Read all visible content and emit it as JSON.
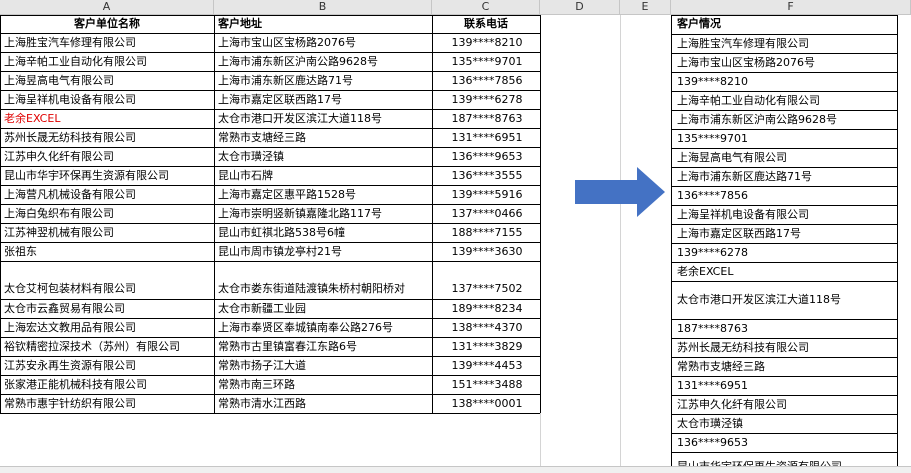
{
  "columns": [
    "A",
    "B",
    "C",
    "D",
    "E",
    "F"
  ],
  "left_headers": [
    "客户单位名称",
    "客户地址",
    "联系电话"
  ],
  "right_header": "客户情况",
  "rows": [
    {
      "name": "上海胜宝汽车修理有限公司",
      "addr": "上海市宝山区宝杨路2076号",
      "phone": "139****8210"
    },
    {
      "name": "上海辛帕工业自动化有限公司",
      "addr": "上海市浦东新区沪南公路9628号",
      "phone": "135****9701"
    },
    {
      "name": "上海昱高电气有限公司",
      "addr": "上海市浦东新区鹿达路71号",
      "phone": "136****7856"
    },
    {
      "name": "上海呈祥机电设备有限公司",
      "addr": "上海市嘉定区联西路17号",
      "phone": "139****6278"
    },
    {
      "name": "老余EXCEL",
      "addr": "太仓市港口开发区滨江大道118号",
      "phone": "187****8763"
    },
    {
      "name": "苏州长晟无纺科技有限公司",
      "addr": "常熟市支塘经三路",
      "phone": "131****6951"
    },
    {
      "name": "江苏申久化纤有限公司",
      "addr": "太仓市璜泾镇",
      "phone": "136****9653"
    },
    {
      "name": "昆山市华宇环保再生资源有限公司",
      "addr": "昆山市石牌",
      "phone": "136****3555"
    },
    {
      "name": "上海营凡机械设备有限公司",
      "addr": "上海市嘉定区惠平路1528号",
      "phone": "139****5916"
    },
    {
      "name": "上海白兔织布有限公司",
      "addr": "上海市崇明竖新镇嘉隆北路117号",
      "phone": "137****0466"
    },
    {
      "name": "江苏神翌机械有限公司",
      "addr": "昆山市虹祺北路538号6幢",
      "phone": "188****7155"
    },
    {
      "name": "张祖东",
      "addr": "昆山市周市镇龙亭村21号",
      "phone": "139****3630"
    },
    {
      "name": "太仓艾柯包装材料有限公司",
      "addr": "太仓市娄东街道陆渡镇朱桥村朝阳桥对",
      "phone": "137****7502"
    },
    {
      "name": "太仓市云鑫贸易有限公司",
      "addr": "太仓市新疆工业园",
      "phone": "189****8234"
    },
    {
      "name": "上海宏达文教用品有限公司",
      "addr": "上海市奉贤区奉城镇南奉公路276号",
      "phone": "138****4370"
    },
    {
      "name": "裕钦精密拉深技术（苏州）有限公司",
      "addr": "常熟市古里镇富春江东路6号",
      "phone": "131****3829"
    },
    {
      "name": "江苏安永再生资源有限公司",
      "addr": "常熟市扬子江大道",
      "phone": "139****4453"
    },
    {
      "name": "张家港正能机械科技有限公司",
      "addr": "常熟市南三环路",
      "phone": "151****3488"
    },
    {
      "name": "常熟市惠宇针纺织有限公司",
      "addr": "常熟市清水江西路",
      "phone": "138****0001"
    }
  ],
  "right_cells": [
    "上海胜宝汽车修理有限公司",
    "上海市宝山区宝杨路2076号",
    "139****8210",
    "上海辛帕工业自动化有限公司",
    "上海市浦东新区沪南公路9628号",
    "135****9701",
    "上海昱高电气有限公司",
    "上海市浦东新区鹿达路71号",
    "136****7856",
    "上海呈祥机电设备有限公司",
    "上海市嘉定区联西路17号",
    "139****6278",
    "老余EXCEL",
    "太仓市港口开发区滨江大道118号",
    "187****8763",
    "苏州长晟无纺科技有限公司",
    "常熟市支塘经三路",
    "131****6951",
    "江苏申久化纤有限公司",
    "太仓市璜泾镇",
    "136****9653",
    "昆山市华宇环保再生资源有限公司"
  ],
  "colors": {
    "header_bg": "#e6e6e6",
    "red_text": "#e00000",
    "arrow": "#4472c4"
  },
  "icons": {
    "arrow": "right-arrow-icon"
  }
}
